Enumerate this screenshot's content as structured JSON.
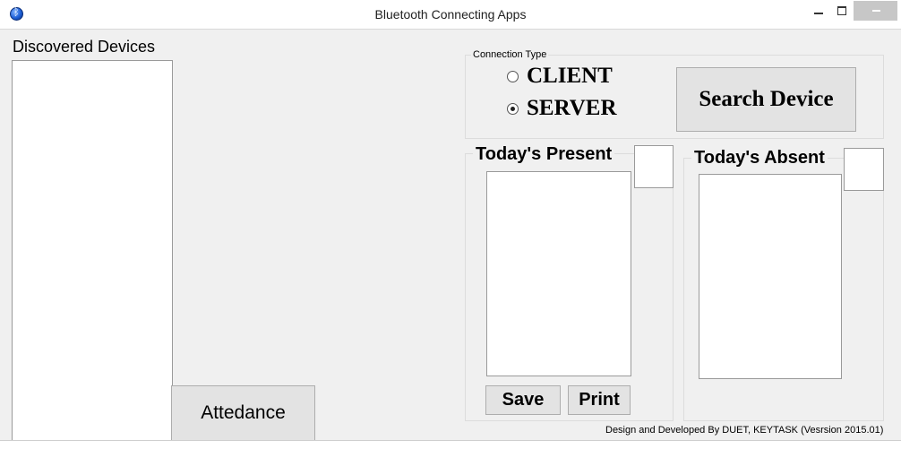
{
  "window": {
    "title": "Bluetooth Connecting Apps",
    "icon": "bluetooth-icon"
  },
  "left": {
    "discovered_label": "Discovered Devices",
    "attendance_button": "Attedance"
  },
  "connection": {
    "group_label": "Connection Type",
    "client_label": "CLIENT",
    "server_label": "SERVER",
    "selected": "SERVER"
  },
  "search_button": "Search Device",
  "present": {
    "label": "Today's Present",
    "save_button": "Save",
    "print_button": "Print"
  },
  "absent": {
    "label": "Today's Absent"
  },
  "footer": {
    "credit": "Design and Developed By DUET,  KEYTASK    (Vesrsion 2015.01)"
  }
}
